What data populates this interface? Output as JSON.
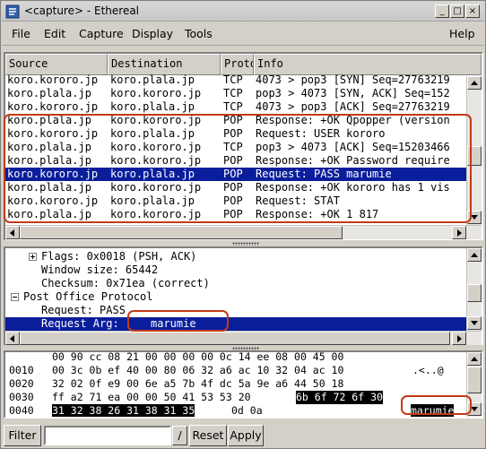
{
  "window": {
    "title": "<capture> - Ethereal",
    "buttons": {
      "minimize": "_",
      "maximize": "□",
      "close": "×"
    }
  },
  "menubar": {
    "items": [
      "File",
      "Edit",
      "Capture",
      "Display",
      "Tools"
    ],
    "help": "Help"
  },
  "packet_list": {
    "columns": [
      "Source",
      "Destination",
      "Protocol",
      "Info"
    ],
    "rows": [
      {
        "source": "koro.kororo.jp",
        "destination": "koro.plala.jp",
        "protocol": "TCP",
        "info": "4073 > pop3 [SYN] Seq=27763219"
      },
      {
        "source": "koro.plala.jp",
        "destination": "koro.kororo.jp",
        "protocol": "TCP",
        "info": "pop3 > 4073 [SYN, ACK] Seq=152"
      },
      {
        "source": "koro.kororo.jp",
        "destination": "koro.plala.jp",
        "protocol": "TCP",
        "info": "4073 > pop3 [ACK] Seq=27763219"
      },
      {
        "source": "koro.plala.jp",
        "destination": "koro.kororo.jp",
        "protocol": "POP",
        "info": "Response: +OK Qpopper (version"
      },
      {
        "source": "koro.kororo.jp",
        "destination": "koro.plala.jp",
        "protocol": "POP",
        "info": "Request: USER kororo"
      },
      {
        "source": "koro.plala.jp",
        "destination": "koro.kororo.jp",
        "protocol": "TCP",
        "info": "pop3 > 4073 [ACK] Seq=15203466"
      },
      {
        "source": "koro.plala.jp",
        "destination": "koro.kororo.jp",
        "protocol": "POP",
        "info": "Response: +OK Password require"
      },
      {
        "source": "koro.kororo.jp",
        "destination": "koro.plala.jp",
        "protocol": "POP",
        "info": "Request: PASS     marumie",
        "selected": true
      },
      {
        "source": "koro.plala.jp",
        "destination": "koro.kororo.jp",
        "protocol": "POP",
        "info": "Response: +OK kororo has 1 vis"
      },
      {
        "source": "koro.kororo.jp",
        "destination": "koro.plala.jp",
        "protocol": "POP",
        "info": "Request: STAT"
      },
      {
        "source": "koro.plala.jp",
        "destination": "koro.kororo.jp",
        "protocol": "POP",
        "info": "Response: +OK 1 817"
      }
    ]
  },
  "details": {
    "rows": [
      {
        "text": "Flags: 0x0018 (PSH, ACK)",
        "expander": "plus"
      },
      {
        "text": "Window size: 65442"
      },
      {
        "text": "Checksum: 0x71ea (correct)"
      },
      {
        "text": "Post Office Protocol",
        "expander": "minus"
      },
      {
        "text": "Request: PASS"
      },
      {
        "text": "Request Arg:",
        "value": "marumie",
        "selected": true
      }
    ]
  },
  "hex": {
    "rows": [
      {
        "offset": "",
        "bytes": "00 90 cc 08 21 00 00 00  00 0c 14 ee 08 00 45 00",
        "ascii": ""
      },
      {
        "offset": "0010",
        "bytes": "00 3c 0b ef 40 00 80 06  32 a6 ac 10 32 04 ac 10",
        "ascii": ".<..@ "
      },
      {
        "offset": "0020",
        "bytes": "32 02 0f e9 00 6e a5 7b  4f dc 5a 9e a6 44 50 18",
        "ascii": ""
      },
      {
        "offset": "0030",
        "bytes_plain": "ff a2 71 ea 00 00 50 41  53 53 20",
        "bytes_hl": "6b 6f 72 6f 30",
        "ascii": ""
      },
      {
        "offset": "0040",
        "bytes_hl": "31 32 38 26 31 38 31 35",
        "bytes_plain": "0d 0a",
        "ascii": "marumie"
      }
    ]
  },
  "filterbar": {
    "filter_label": "Filter",
    "input_value": "",
    "apply_icon": "/",
    "reset_label": "Reset",
    "apply_label": "Apply"
  }
}
